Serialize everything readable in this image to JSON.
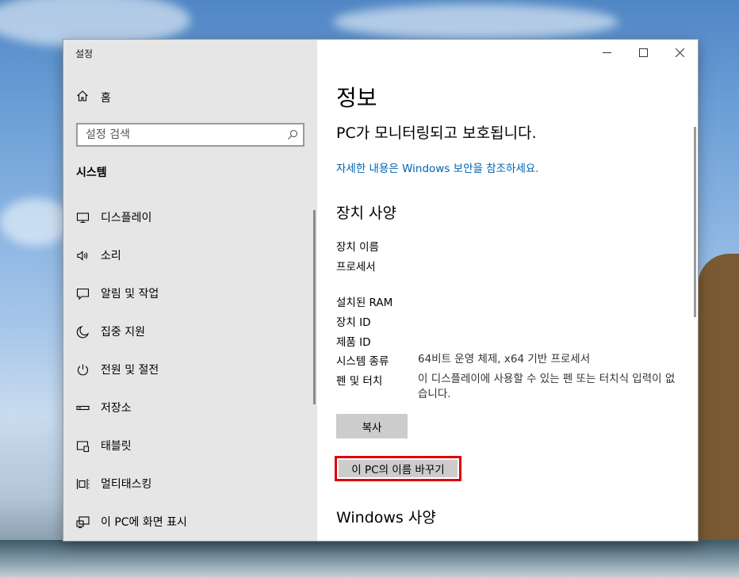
{
  "window": {
    "app_title": "설정"
  },
  "sidebar": {
    "home_label": "홈",
    "search_placeholder": "설정 검색",
    "section_title": "시스템",
    "items": [
      {
        "label": "디스플레이",
        "icon": "monitor-icon"
      },
      {
        "label": "소리",
        "icon": "speaker-icon"
      },
      {
        "label": "알림 및 작업",
        "icon": "notification-icon"
      },
      {
        "label": "집중 지원",
        "icon": "moon-icon"
      },
      {
        "label": "전원 및 절전",
        "icon": "power-icon"
      },
      {
        "label": "저장소",
        "icon": "storage-icon"
      },
      {
        "label": "태블릿",
        "icon": "tablet-icon"
      },
      {
        "label": "멀티태스킹",
        "icon": "multitasking-icon"
      },
      {
        "label": "이 PC에 화면 표시",
        "icon": "project-icon"
      }
    ]
  },
  "main": {
    "title": "정보",
    "protection_text": "PC가 모니터링되고 보호됩니다.",
    "security_link": "자세한 내용은 Windows 보안을 참조하세요.",
    "device_specs_heading": "장치 사양",
    "specs": {
      "device_name": {
        "label": "장치 이름",
        "value": ""
      },
      "processor": {
        "label": "프로세서",
        "value": ""
      },
      "ram": {
        "label": "설치된 RAM",
        "value": ""
      },
      "device_id": {
        "label": "장치 ID",
        "value": ""
      },
      "product_id": {
        "label": "제품 ID",
        "value": ""
      },
      "system_type": {
        "label": "시스템 종류",
        "value": "64비트 운영 체제, x64 기반 프로세서"
      },
      "pen_touch": {
        "label": "펜 및 터치",
        "value": "이 디스플레이에 사용할 수 있는 펜 또는 터치식 입력이 없습니다."
      }
    },
    "copy_button": "복사",
    "rename_button": "이 PC의 이름 바꾸기",
    "windows_specs_heading": "Windows 사양"
  },
  "colors": {
    "link": "#0063b1",
    "highlight": "#e00000",
    "sidebar_bg": "#e6e6e6"
  }
}
